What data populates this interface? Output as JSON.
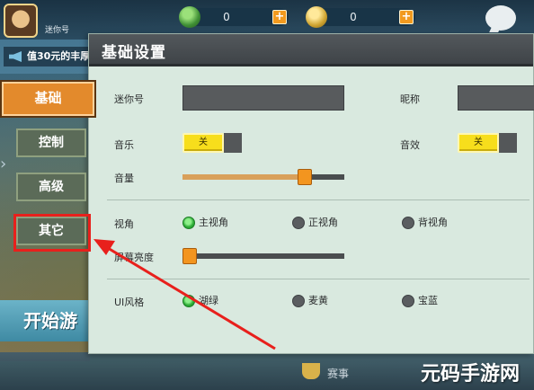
{
  "top_bar": {
    "player_info": "迷你号",
    "currency_1": {
      "count": "0",
      "plus": "+"
    },
    "currency_2": {
      "count": "0",
      "plus": "+"
    }
  },
  "promo": {
    "text": "值30元的丰厚"
  },
  "start_button": {
    "label": "开始游"
  },
  "bottom_bar": {
    "event_label": "赛事"
  },
  "tabs": [
    "基础",
    "控制",
    "高级",
    "其它"
  ],
  "settings": {
    "title": "基础设置",
    "mini_id_label": "迷你号",
    "nickname_label": "昵称",
    "music_label": "音乐",
    "music_value": "关",
    "sfx_label": "音效",
    "sfx_value": "关",
    "volume_label": "音量",
    "volume_level": 0.78,
    "view_label": "视角",
    "view_options": [
      "主视角",
      "正视角",
      "背视角"
    ],
    "view_selected": 0,
    "brightness_label": "屏幕亮度",
    "brightness_level": 0.0,
    "ui_style_label": "UI风格",
    "ui_style_options": [
      "湖绿",
      "麦黄",
      "宝蓝"
    ],
    "ui_style_selected": 0
  },
  "colors": {
    "panel_bg": "#d9e9df",
    "active_tab": "#e38a2c",
    "toggle_yellow": "#f7de1c",
    "radio_selected": "#2aa934",
    "annotation_red": "#e8201c"
  },
  "watermark": "元码手游网"
}
